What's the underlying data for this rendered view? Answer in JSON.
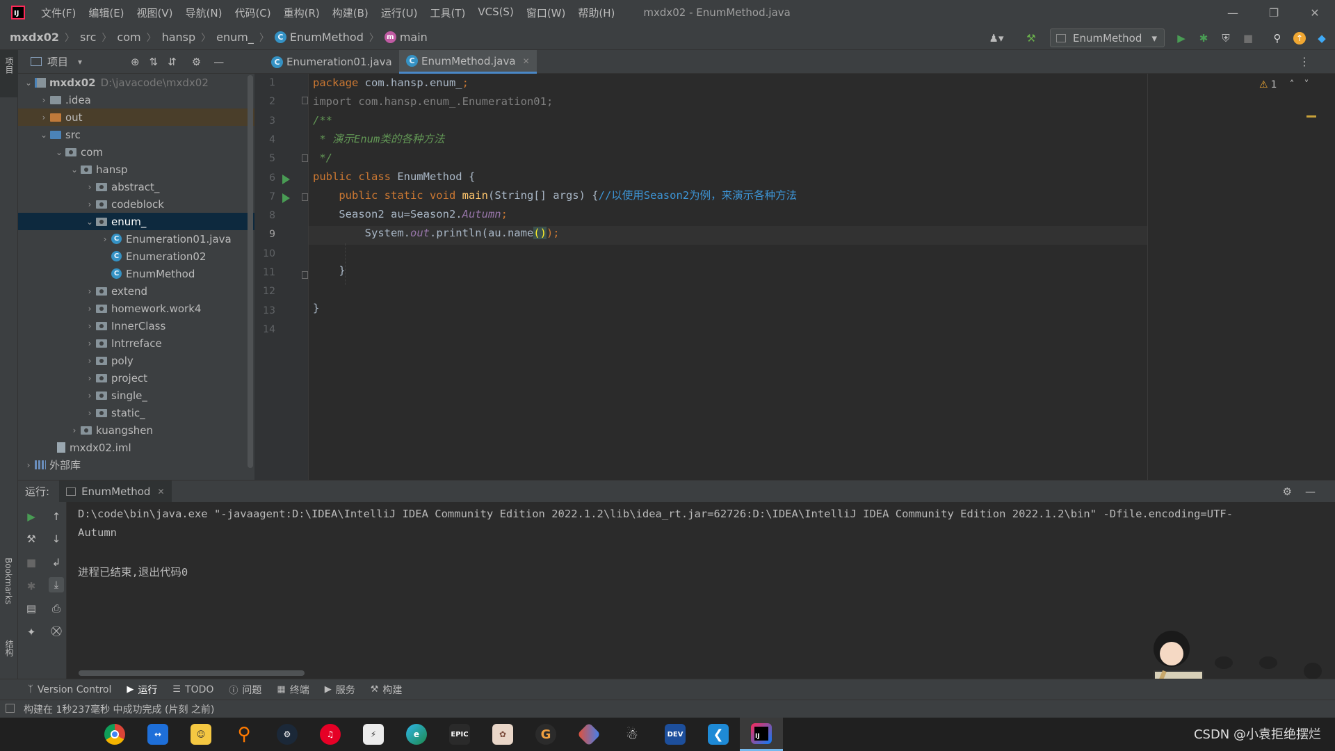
{
  "titlebar": {
    "menus": [
      "文件(F)",
      "编辑(E)",
      "视图(V)",
      "导航(N)",
      "代码(C)",
      "重构(R)",
      "构建(B)",
      "运行(U)",
      "工具(T)",
      "VCS(S)",
      "窗口(W)",
      "帮助(H)"
    ],
    "window_title": "mxdx02 - EnumMethod.java"
  },
  "breadcrumb": {
    "project": "mxdx02",
    "items": [
      "src",
      "com",
      "hansp",
      "enum_"
    ],
    "class": "EnumMethod",
    "method": "main"
  },
  "run_config": {
    "label": "EnumMethod"
  },
  "left_strip": {
    "project_label": "项目",
    "bookmarks_label": "Bookmarks",
    "structure_label": "结构"
  },
  "project_panel": {
    "title": "项目",
    "tree": [
      {
        "label": "mxdx02",
        "path": "D:\\javacode\\mxdx02"
      },
      {
        "label": ".idea"
      },
      {
        "label": "out"
      },
      {
        "label": "src"
      },
      {
        "label": "com"
      },
      {
        "label": "hansp"
      },
      {
        "label": "abstract_"
      },
      {
        "label": "codeblock"
      },
      {
        "label": "enum_"
      },
      {
        "label": "Enumeration01.java"
      },
      {
        "label": "Enumeration02"
      },
      {
        "label": "EnumMethod"
      },
      {
        "label": "extend"
      },
      {
        "label": "homework.work4"
      },
      {
        "label": "InnerClass"
      },
      {
        "label": "Intrreface"
      },
      {
        "label": "poly"
      },
      {
        "label": "project"
      },
      {
        "label": "single_"
      },
      {
        "label": "static_"
      },
      {
        "label": "kuangshen"
      },
      {
        "label": "mxdx02.iml"
      },
      {
        "label": "外部库"
      }
    ]
  },
  "editor": {
    "tabs": [
      {
        "label": "Enumeration01.java"
      },
      {
        "label": "EnumMethod.java"
      }
    ],
    "line_numbers": [
      "1",
      "2",
      "3",
      "4",
      "5",
      "6",
      "7",
      "8",
      "9",
      "10",
      "11",
      "12",
      "13",
      "14"
    ],
    "current_line": 9,
    "warnings_count": "1",
    "code": {
      "l1_kw": "package",
      "l1_rest": " com.hansp.enum_",
      "l1_semi": ";",
      "l2": "import com.hansp.enum_.Enumeration01;",
      "l3": "/**",
      "l4": " * 演示Enum类的各种方法",
      "l5": " */",
      "l6_kw": "public class",
      "l6_rest": " EnumMethod {",
      "l7_kw": "    public static void",
      "l7_fn": " main",
      "l7_rest": "(String[] args) {",
      "l7_cmt": "//以使用Season2为例，来演示各种方法",
      "l8_a": "    Season2 au=Season2.",
      "l8_b": "Autumn",
      "l8_c": ";",
      "l9_a": "        System.",
      "l9_b": "out",
      "l9_c": ".println(au.name",
      "l9_d": "()",
      "l9_e": ");",
      "l11": "    }",
      "l13": "}"
    }
  },
  "run_panel": {
    "label": "运行:",
    "tab": "EnumMethod",
    "console": [
      "D:\\code\\bin\\java.exe \"-javaagent:D:\\IDEA\\IntelliJ IDEA Community Edition 2022.1.2\\lib\\idea_rt.jar=62726:D:\\IDEA\\IntelliJ IDEA Community Edition 2022.1.2\\bin\" -Dfile.encoding=UTF-",
      "Autumn",
      "",
      "进程已结束,退出代码0"
    ]
  },
  "bottom_tools": {
    "items": [
      "Version Control",
      "运行",
      "TODO",
      "问题",
      "终端",
      "服务",
      "构建"
    ]
  },
  "status": {
    "message": "构建在 1秒237毫秒 中成功完成 (片刻 之前)"
  },
  "taskbar": {
    "apps": [
      "chrome-icon",
      "teamviewer-icon",
      "bilibili-icon",
      "search-app-icon",
      "steam-icon",
      "netease-music-icon",
      "kugou-icon",
      "edge-icon",
      "epic-games-icon",
      "genshin-icon",
      "grammarly-icon",
      "git-icon",
      "qq-icon",
      "devcpp-icon",
      "vscode-icon",
      "intellij-icon"
    ],
    "tray_text": "CSDN @小袁拒绝摆烂"
  },
  "colors": {
    "accent": "#4a88c7",
    "run_green": "#499c54",
    "keyword": "#cc7832",
    "comment": "#629755"
  }
}
